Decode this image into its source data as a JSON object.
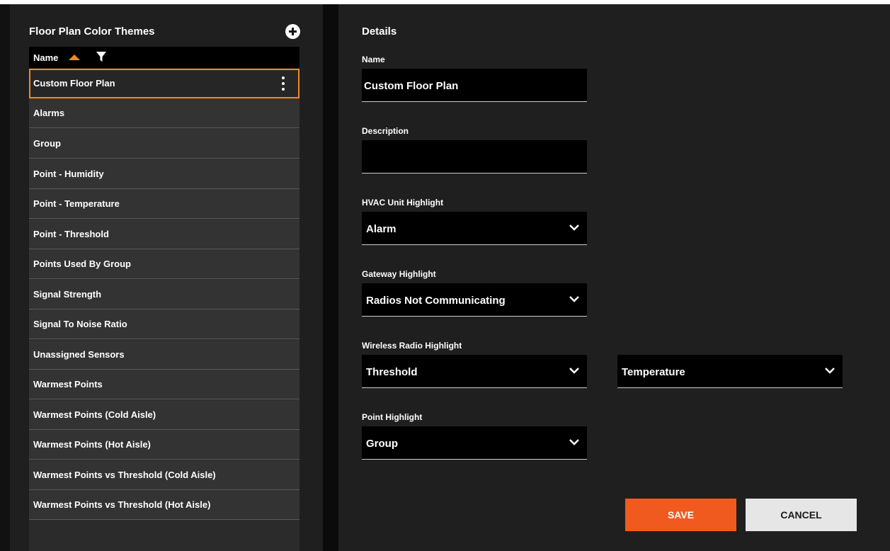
{
  "left": {
    "title": "Floor Plan Color Themes",
    "column_name": "Name",
    "items": [
      {
        "label": "Custom Floor Plan",
        "selected": true
      },
      {
        "label": "Alarms"
      },
      {
        "label": "Group"
      },
      {
        "label": "Point - Humidity"
      },
      {
        "label": "Point - Temperature"
      },
      {
        "label": "Point - Threshold"
      },
      {
        "label": "Points Used By Group"
      },
      {
        "label": "Signal Strength"
      },
      {
        "label": "Signal To Noise Ratio"
      },
      {
        "label": "Unassigned Sensors"
      },
      {
        "label": "Warmest Points"
      },
      {
        "label": "Warmest Points (Cold Aisle)"
      },
      {
        "label": "Warmest Points (Hot Aisle)"
      },
      {
        "label": "Warmest Points vs Threshold (Cold Aisle)"
      },
      {
        "label": "Warmest Points vs Threshold (Hot Aisle)"
      }
    ]
  },
  "details": {
    "title": "Details",
    "name_label": "Name",
    "name_value": "Custom Floor Plan",
    "description_label": "Description",
    "description_value": "",
    "hvac_label": "HVAC Unit Highlight",
    "hvac_value": "Alarm",
    "gateway_label": "Gateway Highlight",
    "gateway_value": "Radios Not Communicating",
    "wireless_label": "Wireless Radio Highlight",
    "wireless_value": "Threshold",
    "wireless_value2": "Temperature",
    "point_label": "Point Highlight",
    "point_value": "Group"
  },
  "actions": {
    "save": "SAVE",
    "cancel": "CANCEL"
  },
  "colors": {
    "accent": "#f08a24",
    "save_button": "#f05a1e",
    "cancel_button": "#e6e6e6"
  }
}
